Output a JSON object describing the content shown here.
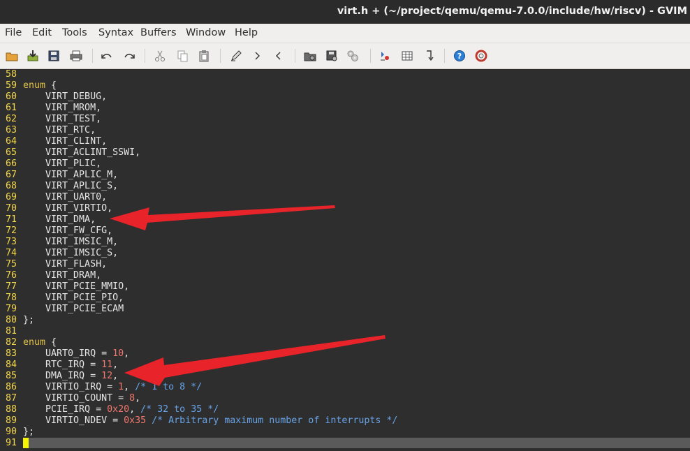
{
  "window": {
    "title": "virt.h + (~/project/qemu/qemu-7.0.0/include/hw/riscv) - GVIM"
  },
  "menu": [
    "File",
    "Edit",
    "Tools",
    "Syntax",
    "Buffers",
    "Window",
    "Help"
  ],
  "toolbar": [
    {
      "name": "open-icon",
      "glyph": "folder"
    },
    {
      "name": "save-session-icon",
      "glyph": "download"
    },
    {
      "name": "save-icon",
      "glyph": "floppy"
    },
    {
      "name": "print-icon",
      "glyph": "printer"
    },
    {
      "name": "undo-icon",
      "glyph": "undo"
    },
    {
      "name": "redo-icon",
      "glyph": "redo"
    },
    {
      "name": "cut-icon",
      "glyph": "scissors"
    },
    {
      "name": "copy-icon",
      "glyph": "copy"
    },
    {
      "name": "paste-icon",
      "glyph": "clipboard"
    },
    {
      "name": "find-replace-icon",
      "glyph": "pen"
    },
    {
      "name": "find-next-icon",
      "glyph": "chevron-right"
    },
    {
      "name": "find-prev-icon",
      "glyph": "chevron-left"
    },
    {
      "name": "load-session-icon",
      "glyph": "folder-gear"
    },
    {
      "name": "save-session-icon-2",
      "glyph": "save-gear"
    },
    {
      "name": "run-script-icon",
      "glyph": "gears"
    },
    {
      "name": "make-icon",
      "glyph": "build"
    },
    {
      "name": "shell-icon",
      "glyph": "table"
    },
    {
      "name": "jump-tag-icon",
      "glyph": "jump"
    },
    {
      "name": "help-icon",
      "glyph": "question"
    },
    {
      "name": "find-help-icon",
      "glyph": "lifebuoy"
    }
  ],
  "colors": {
    "line_number": "#f5d949",
    "keyword": "#e2c34d",
    "number": "#f0786c",
    "comment": "#67a3e6",
    "arrow": "#e8232a"
  },
  "lines": [
    {
      "n": "58",
      "segs": []
    },
    {
      "n": "59",
      "segs": [
        {
          "t": "enum",
          "c": "kw"
        },
        {
          "t": " {"
        }
      ]
    },
    {
      "n": "60",
      "segs": [
        {
          "t": "    VIRT_DEBUG,"
        }
      ]
    },
    {
      "n": "61",
      "segs": [
        {
          "t": "    VIRT_MROM,"
        }
      ]
    },
    {
      "n": "62",
      "segs": [
        {
          "t": "    VIRT_TEST,"
        }
      ]
    },
    {
      "n": "63",
      "segs": [
        {
          "t": "    VIRT_RTC,"
        }
      ]
    },
    {
      "n": "64",
      "segs": [
        {
          "t": "    VIRT_CLINT,"
        }
      ]
    },
    {
      "n": "65",
      "segs": [
        {
          "t": "    VIRT_ACLINT_SSWI,"
        }
      ]
    },
    {
      "n": "66",
      "segs": [
        {
          "t": "    VIRT_PLIC,"
        }
      ]
    },
    {
      "n": "67",
      "segs": [
        {
          "t": "    VIRT_APLIC_M,"
        }
      ]
    },
    {
      "n": "68",
      "segs": [
        {
          "t": "    VIRT_APLIC_S,"
        }
      ]
    },
    {
      "n": "69",
      "segs": [
        {
          "t": "    VIRT_UART0,"
        }
      ]
    },
    {
      "n": "70",
      "segs": [
        {
          "t": "    VIRT_VIRTIO,"
        }
      ]
    },
    {
      "n": "71",
      "segs": [
        {
          "t": "    VIRT_DMA,"
        }
      ]
    },
    {
      "n": "72",
      "segs": [
        {
          "t": "    VIRT_FW_CFG,"
        }
      ]
    },
    {
      "n": "73",
      "segs": [
        {
          "t": "    VIRT_IMSIC_M,"
        }
      ]
    },
    {
      "n": "74",
      "segs": [
        {
          "t": "    VIRT_IMSIC_S,"
        }
      ]
    },
    {
      "n": "75",
      "segs": [
        {
          "t": "    VIRT_FLASH,"
        }
      ]
    },
    {
      "n": "76",
      "segs": [
        {
          "t": "    VIRT_DRAM,"
        }
      ]
    },
    {
      "n": "77",
      "segs": [
        {
          "t": "    VIRT_PCIE_MMIO,"
        }
      ]
    },
    {
      "n": "78",
      "segs": [
        {
          "t": "    VIRT_PCIE_PIO,"
        }
      ]
    },
    {
      "n": "79",
      "segs": [
        {
          "t": "    VIRT_PCIE_ECAM"
        }
      ]
    },
    {
      "n": "80",
      "segs": [
        {
          "t": "};"
        }
      ]
    },
    {
      "n": "81",
      "segs": []
    },
    {
      "n": "82",
      "segs": [
        {
          "t": "enum",
          "c": "kw"
        },
        {
          "t": " {"
        }
      ]
    },
    {
      "n": "83",
      "segs": [
        {
          "t": "    UART0_IRQ = "
        },
        {
          "t": "10",
          "c": "num"
        },
        {
          "t": ","
        }
      ]
    },
    {
      "n": "84",
      "segs": [
        {
          "t": "    RTC_IRQ = "
        },
        {
          "t": "11",
          "c": "num"
        },
        {
          "t": ","
        }
      ]
    },
    {
      "n": "85",
      "segs": [
        {
          "t": "    DMA_IRQ = "
        },
        {
          "t": "12",
          "c": "num"
        },
        {
          "t": ","
        }
      ]
    },
    {
      "n": "86",
      "segs": [
        {
          "t": "    VIRTIO_IRQ = "
        },
        {
          "t": "1",
          "c": "num"
        },
        {
          "t": ", "
        },
        {
          "t": "/* 1 to 8 */",
          "c": "cmt"
        }
      ]
    },
    {
      "n": "87",
      "segs": [
        {
          "t": "    VIRTIO_COUNT = "
        },
        {
          "t": "8",
          "c": "num"
        },
        {
          "t": ","
        }
      ]
    },
    {
      "n": "88",
      "segs": [
        {
          "t": "    PCIE_IRQ = "
        },
        {
          "t": "0x20",
          "c": "num"
        },
        {
          "t": ", "
        },
        {
          "t": "/* 32 to 35 */",
          "c": "cmt"
        }
      ]
    },
    {
      "n": "89",
      "segs": [
        {
          "t": "    VIRTIO_NDEV = "
        },
        {
          "t": "0x35",
          "c": "num"
        },
        {
          "t": " "
        },
        {
          "t": "/* Arbitrary maximum number of interrupts */",
          "c": "cmt"
        }
      ]
    },
    {
      "n": "90",
      "segs": [
        {
          "t": "};"
        }
      ]
    },
    {
      "n": "91",
      "segs": []
    }
  ]
}
